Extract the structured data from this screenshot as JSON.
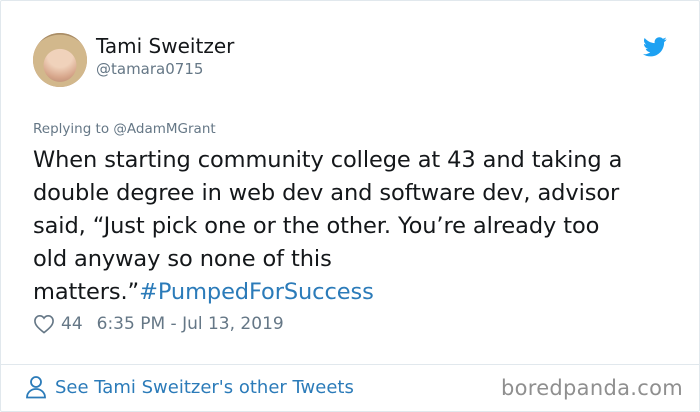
{
  "tweet": {
    "author": {
      "display_name": "Tami Sweitzer",
      "handle": "@tamara0715"
    },
    "reply_to": "Replying to @AdamMGrant",
    "text_lines": [
      "When starting community college at 43 and taking a",
      "double degree in web dev and software dev, advisor",
      "said, “Just pick one or the other. You’re already too",
      "old anyway so none of this",
      "matters.”"
    ],
    "hashtag": "#PumpedForSuccess",
    "likes": "44",
    "timestamp": "6:35 PM - Jul 13, 2019"
  },
  "footer": {
    "other_tweets_link": "See Tami Sweitzer's other Tweets"
  },
  "watermark": "boredpanda.com",
  "colors": {
    "twitter_blue": "#1da1f2",
    "link_blue": "#2b7bb9",
    "secondary_text": "#657786",
    "border": "#e1e8ed"
  },
  "icons": [
    "twitter-bird-icon",
    "heart-icon",
    "person-icon"
  ]
}
